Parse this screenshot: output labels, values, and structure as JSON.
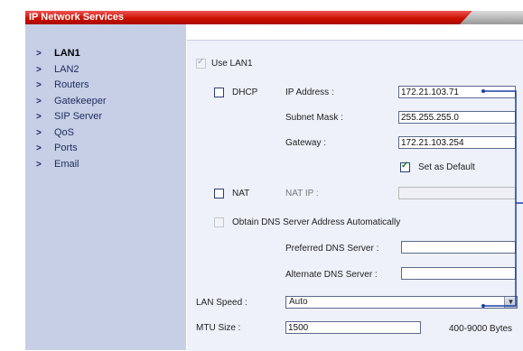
{
  "window": {
    "title": "IP Network Services"
  },
  "sidebar": {
    "items": [
      {
        "label": "LAN1",
        "active": true
      },
      {
        "label": "LAN2"
      },
      {
        "label": "Routers"
      },
      {
        "label": "Gatekeeper"
      },
      {
        "label": "SIP Server"
      },
      {
        "label": "QoS"
      },
      {
        "label": "Ports"
      },
      {
        "label": "Email"
      }
    ],
    "chevron": ">"
  },
  "lan": {
    "use_lan1_label": "Use LAN1",
    "dhcp_label": "DHCP",
    "ip_address_label": "IP Address :",
    "ip_address_value": "172.21.103.71",
    "subnet_mask_label": "Subnet Mask :",
    "subnet_mask_value": "255.255.255.0",
    "gateway_label": "Gateway :",
    "gateway_value": "172.21.103.254",
    "set_default_label": "Set as Default",
    "nat_label": "NAT",
    "nat_ip_label": "NAT IP :",
    "nat_ip_value": "",
    "obtain_dns_label": "Obtain DNS Server Address Automatically",
    "preferred_dns_label": "Preferred DNS Server :",
    "preferred_dns_value": "",
    "alternate_dns_label": "Alternate DNS Server :",
    "alternate_dns_value": "",
    "lan_speed_label": "LAN Speed :",
    "lan_speed_value": "Auto",
    "mtu_label": "MTU Size :",
    "mtu_value": "1500",
    "mtu_range": "400-9000 Bytes"
  },
  "colors": {
    "title_bar": "#c10000",
    "sidebar_bg": "#c6cfe6",
    "panel_bg": "#eef1f9",
    "annotation_line": "#1a3fa8"
  },
  "icons": {
    "check": "✓",
    "dropdown": "▼"
  }
}
